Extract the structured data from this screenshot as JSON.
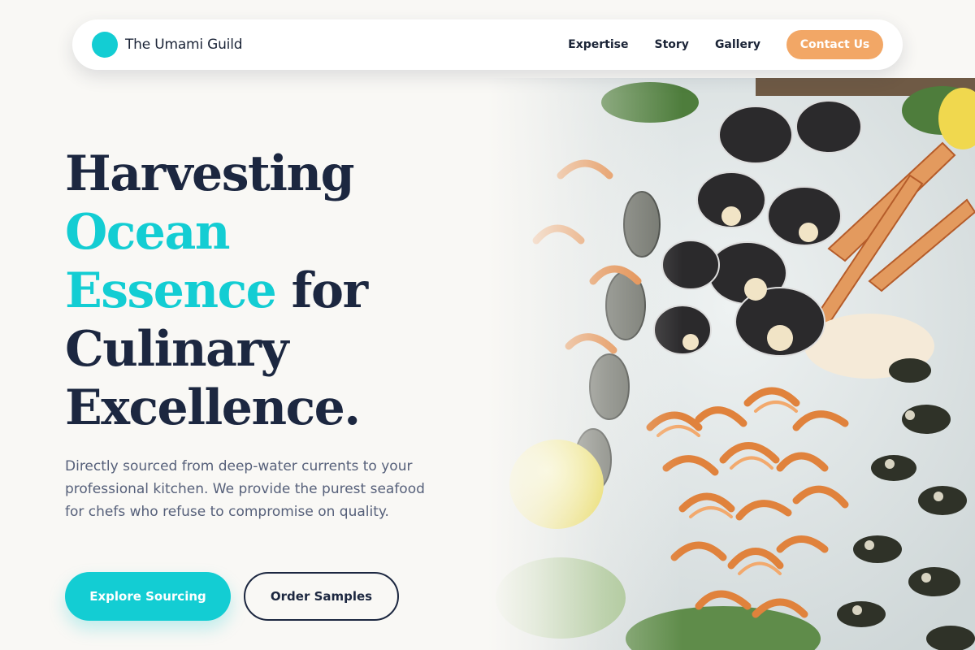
{
  "brand": {
    "name": "The Umami Guild",
    "logo_color": "#13cdd3"
  },
  "nav": {
    "links": [
      {
        "label": "Expertise"
      },
      {
        "label": "Story"
      },
      {
        "label": "Gallery"
      }
    ],
    "cta_label": "Contact Us"
  },
  "hero": {
    "title": {
      "line1": "Harvesting",
      "accent1": "Ocean",
      "accent2": "Essence",
      "after_accent": " for",
      "line4": "Culinary",
      "line5": "Excellence."
    },
    "description": "Directly sourced from deep-water currents to your professional kitchen. We provide the purest seafood for chefs who refuse to compromise on quality.",
    "primary_button": "Explore Sourcing",
    "secondary_button": "Order Samples",
    "image_subject": "seafood platter with shrimp, scallops, crab legs, oysters and barnacles on ice"
  },
  "colors": {
    "accent": "#13cdd3",
    "cta": "#f2a766",
    "heading": "#1c2740",
    "body_text": "#56607a",
    "background": "#f9f8f5"
  }
}
